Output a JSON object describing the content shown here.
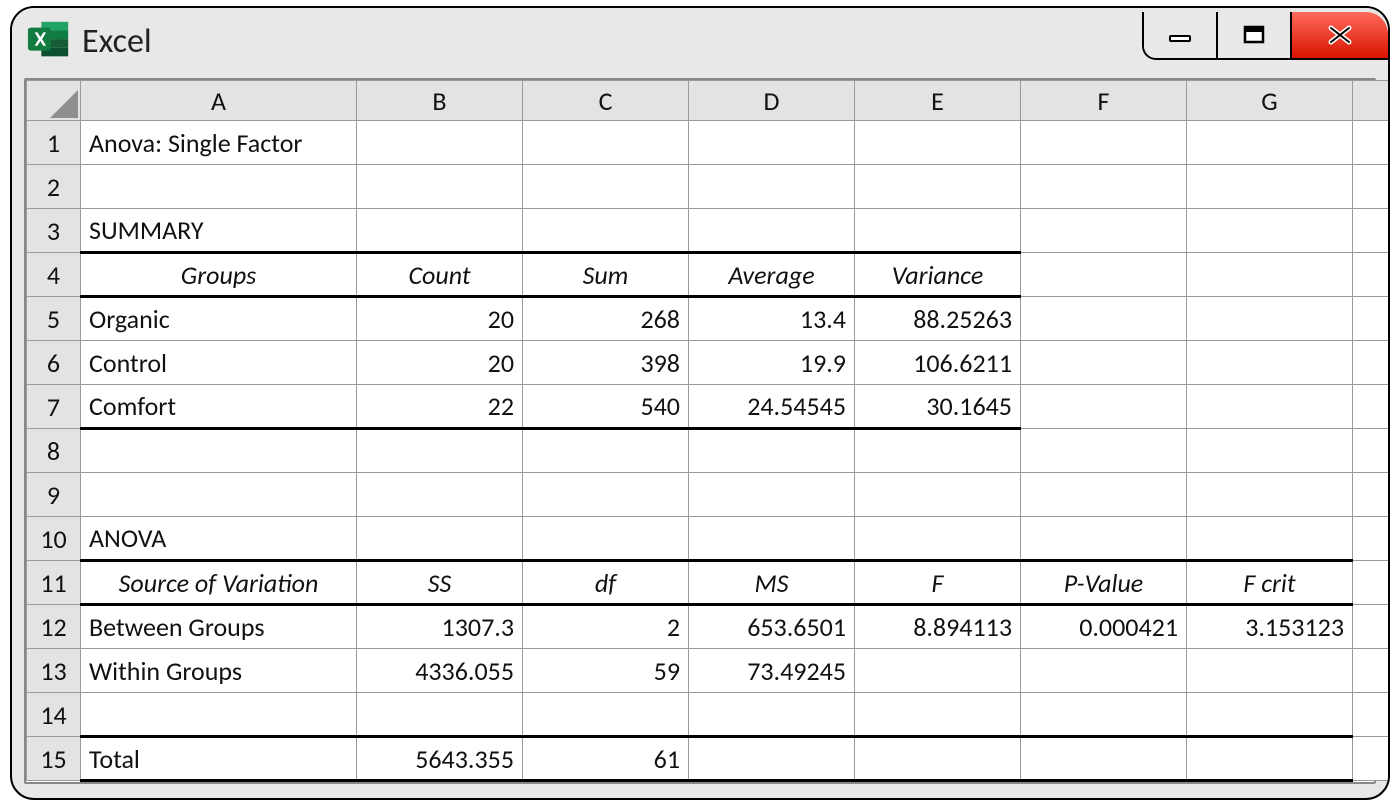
{
  "app": {
    "title": "Excel"
  },
  "columns": [
    "A",
    "B",
    "C",
    "D",
    "E",
    "F",
    "G",
    ""
  ],
  "row_numbers": [
    1,
    2,
    3,
    4,
    5,
    6,
    7,
    8,
    9,
    10,
    11,
    12,
    13,
    14,
    15
  ],
  "cells": {
    "r1": {
      "A": "Anova: Single Factor"
    },
    "r3": {
      "A": "SUMMARY"
    },
    "r4": {
      "A": "Groups",
      "B": "Count",
      "C": "Sum",
      "D": "Average",
      "E": "Variance"
    },
    "r5": {
      "A": "Organic",
      "B": "20",
      "C": "268",
      "D": "13.4",
      "E": "88.25263"
    },
    "r6": {
      "A": "Control",
      "B": "20",
      "C": "398",
      "D": "19.9",
      "E": "106.6211"
    },
    "r7": {
      "A": "Comfort",
      "B": "22",
      "C": "540",
      "D": "24.54545",
      "E": "30.1645"
    },
    "r10": {
      "A": "ANOVA"
    },
    "r11": {
      "A": "Source of Variation",
      "B": "SS",
      "C": "df",
      "D": "MS",
      "E": "F",
      "F": "P-Value",
      "G": "F crit"
    },
    "r12": {
      "A": "Between Groups",
      "B": "1307.3",
      "C": "2",
      "D": "653.6501",
      "E": "8.894113",
      "F": "0.000421",
      "G": "3.153123"
    },
    "r13": {
      "A": "Within Groups",
      "B": "4336.055",
      "C": "59",
      "D": "73.49245"
    },
    "r15": {
      "A": "Total",
      "B": "5643.355",
      "C": "61"
    }
  },
  "chart_data": {
    "type": "table",
    "title": "Anova: Single Factor",
    "summary": {
      "headers": [
        "Groups",
        "Count",
        "Sum",
        "Average",
        "Variance"
      ],
      "rows": [
        {
          "Groups": "Organic",
          "Count": 20,
          "Sum": 268,
          "Average": 13.4,
          "Variance": 88.25263
        },
        {
          "Groups": "Control",
          "Count": 20,
          "Sum": 398,
          "Average": 19.9,
          "Variance": 106.6211
        },
        {
          "Groups": "Comfort",
          "Count": 22,
          "Sum": 540,
          "Average": 24.54545,
          "Variance": 30.1645
        }
      ]
    },
    "anova": {
      "headers": [
        "Source of Variation",
        "SS",
        "df",
        "MS",
        "F",
        "P-Value",
        "F crit"
      ],
      "rows": [
        {
          "Source of Variation": "Between Groups",
          "SS": 1307.3,
          "df": 2,
          "MS": 653.6501,
          "F": 8.894113,
          "P-Value": 0.000421,
          "F crit": 3.153123
        },
        {
          "Source of Variation": "Within Groups",
          "SS": 4336.055,
          "df": 59,
          "MS": 73.49245
        },
        {
          "Source of Variation": "Total",
          "SS": 5643.355,
          "df": 61
        }
      ]
    }
  }
}
